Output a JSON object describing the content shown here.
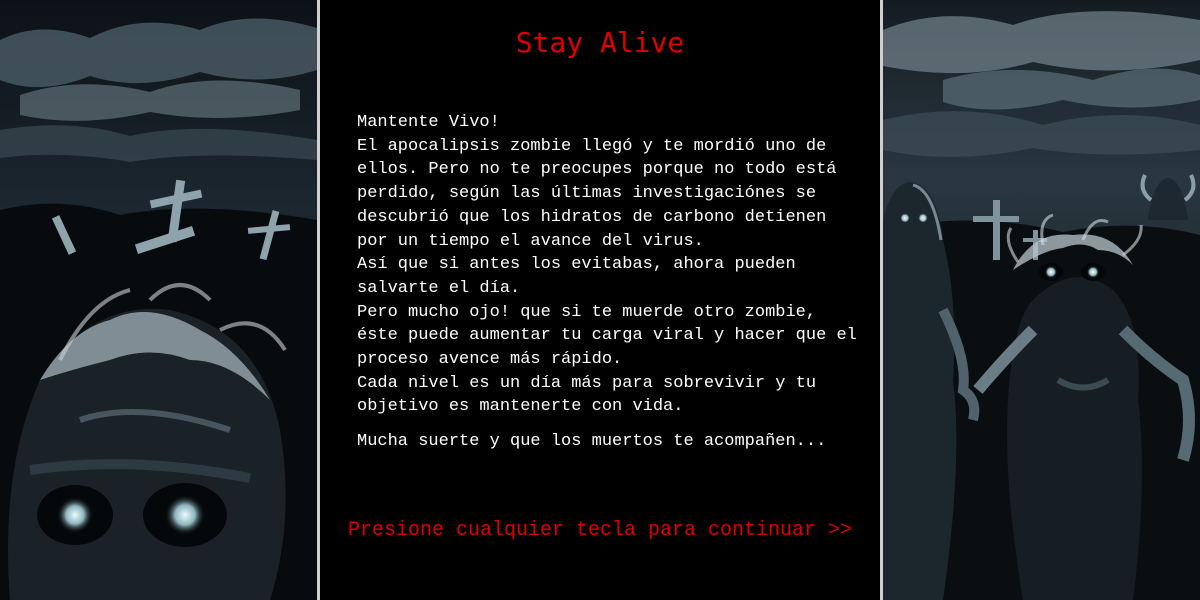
{
  "title": "Stay Alive",
  "story": {
    "lines": [
      "Mantente Vivo!",
      "El apocalipsis zombie llegó y te mordió uno de",
      "ellos. Pero no te preocupes porque no todo está",
      "perdido, según las últimas investigaciónes se",
      "descubrió que los hidratos de carbono detienen",
      "por un tiempo el avance del virus.",
      "Así que si antes los evitabas, ahora pueden",
      "salvarte el día.",
      "Pero mucho ojo! que si te muerde otro zombie,",
      "éste puede aumentar tu carga viral y hacer que el",
      "proceso avence más rápido.",
      "Cada nivel es un día más para sobrevivir y tu",
      "objetivo es mantenerte con vida."
    ],
    "closing": "Mucha suerte y que los muertos te acompañen..."
  },
  "prompt": "Presione cualquier tecla para continuar >>",
  "colors": {
    "accent_red": "#e00000",
    "text_white": "#ffffff",
    "background": "#000000",
    "divider": "#cfcfcf"
  }
}
